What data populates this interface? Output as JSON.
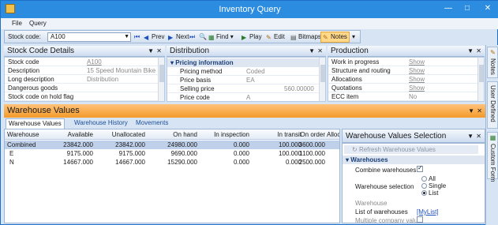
{
  "window": {
    "title": "Inventory Query"
  },
  "menu": [
    "File",
    "Query"
  ],
  "toolbar": {
    "stock_code_label": "Stock code:",
    "stock_code_value": "A100",
    "prev": "Prev",
    "next": "Next",
    "find": "Find",
    "play": "Play",
    "edit": "Edit",
    "bitmaps": "Bitmaps",
    "notes": "Notes"
  },
  "stock_code_details": {
    "title": "Stock Code Details",
    "rows": [
      {
        "label": "Stock code",
        "value": "A100",
        "link": true
      },
      {
        "label": "Description",
        "value": "15 Speed Mountain Bike Bo",
        "link": false
      },
      {
        "label": "Long description",
        "value": "Distribution",
        "link": false
      },
      {
        "label": "Dangerous goods",
        "value": "",
        "link": false
      },
      {
        "label": "Stock code on hold flag",
        "value": "",
        "link": false
      }
    ]
  },
  "distribution": {
    "title": "Distribution",
    "section": "Pricing information",
    "rows": [
      {
        "label": "Pricing method",
        "value": "Coded"
      },
      {
        "label": "Price basis",
        "value": "EA"
      },
      {
        "label": "Selling price",
        "value": "560.00000"
      },
      {
        "label": "Price code",
        "value": "A"
      }
    ]
  },
  "production": {
    "title": "Production",
    "rows": [
      {
        "label": "Work in progress",
        "value": "Show",
        "link": true
      },
      {
        "label": "Structure and routing",
        "value": "Show",
        "link": true
      },
      {
        "label": "Allocations",
        "value": "Show",
        "link": true
      },
      {
        "label": "Quotations",
        "value": "Show",
        "link": true
      },
      {
        "label": "ECC item",
        "value": "No",
        "link": false
      }
    ]
  },
  "warehouse_values": {
    "title": "Warehouse Values",
    "tabs": [
      "Warehouse Values",
      "Warehouse History",
      "Movements"
    ],
    "columns": [
      "Warehouse",
      "Available",
      "Unallocated",
      "On hand",
      "In inspection",
      "In transit",
      "On order",
      "Allocat"
    ],
    "rows": [
      [
        "Combined",
        "23842.000",
        "23842.000",
        "24980.000",
        "0.000",
        "100.000",
        "3600.000",
        ""
      ],
      [
        "E",
        "9175.000",
        "9175.000",
        "9690.000",
        "0.000",
        "100.000",
        "1100.000",
        ""
      ],
      [
        "N",
        "14667.000",
        "14667.000",
        "15290.000",
        "0.000",
        "0.000",
        "2500.000",
        ""
      ]
    ]
  },
  "selection_pane": {
    "title": "Warehouse Values Selection",
    "refresh_label": "Refresh Warehouse Values",
    "section": "Warehouses",
    "combine_label": "Combine warehouses",
    "selection_label": "Warehouse selection",
    "options": [
      "All",
      "Single",
      "List"
    ],
    "selected_option": "List",
    "warehouse_label": "Warehouse",
    "list_label": "List of warehouses",
    "list_value": "[MyList]",
    "multi_company_label": "Multiple company value"
  },
  "side_tabs": [
    "Notes",
    "User Defined",
    "Custom Form"
  ]
}
